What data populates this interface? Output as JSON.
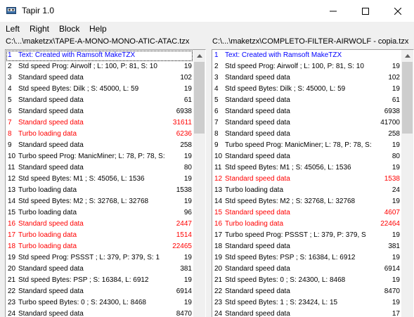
{
  "window": {
    "title": "Tapir 1.0",
    "minimize_glyph": "—",
    "maximize_glyph": "☐",
    "close_glyph": "✕"
  },
  "menu": [
    "Left",
    "Right",
    "Block",
    "Help"
  ],
  "left_panel": {
    "path": "C:\\...\\maketzx\\TAPE-A-MONO-MONO-ATIC-ATAC.tzx",
    "rows": [
      {
        "num": "1",
        "text": "Text: Created with Ramsoft MakeTZX",
        "value": "",
        "color": "blue"
      },
      {
        "num": "2",
        "text": "Std speed Prog: Airwolf   ; L: 100, P: 81, S: 10",
        "value": "19",
        "color": "black"
      },
      {
        "num": "3",
        "text": "Standard speed data",
        "value": "102",
        "color": "black"
      },
      {
        "num": "4",
        "text": "Std speed Bytes: Dilk      ; S: 45000, L: 59",
        "value": "19",
        "color": "black"
      },
      {
        "num": "5",
        "text": "Standard speed data",
        "value": "61",
        "color": "black"
      },
      {
        "num": "6",
        "text": "Standard speed data",
        "value": "6938",
        "color": "black"
      },
      {
        "num": "7",
        "text": "Standard speed data",
        "value": "31611",
        "color": "red"
      },
      {
        "num": "8",
        "text": "Turbo loading data",
        "value": "6236",
        "color": "red"
      },
      {
        "num": "9",
        "text": "Standard speed data",
        "value": "258",
        "color": "black"
      },
      {
        "num": "10",
        "text": "Turbo speed Prog: ManicMiner; L: 78, P: 78, S:",
        "value": "19",
        "color": "black"
      },
      {
        "num": "11",
        "text": "Standard speed data",
        "value": "80",
        "color": "black"
      },
      {
        "num": "12",
        "text": "Std speed Bytes: M1        ; S: 45056, L: 1536",
        "value": "19",
        "color": "black"
      },
      {
        "num": "13",
        "text": "Turbo loading data",
        "value": "1538",
        "color": "black"
      },
      {
        "num": "14",
        "text": "Std speed Bytes: M2        ; S: 32768, L: 32768",
        "value": "19",
        "color": "black"
      },
      {
        "num": "15",
        "text": "Turbo loading data",
        "value": "96",
        "color": "black"
      },
      {
        "num": "16",
        "text": "Standard speed data",
        "value": "2447",
        "color": "red"
      },
      {
        "num": "17",
        "text": "Turbo loading data",
        "value": "1514",
        "color": "red"
      },
      {
        "num": "18",
        "text": "Turbo loading data",
        "value": "22465",
        "color": "red"
      },
      {
        "num": "19",
        "text": "Std speed Prog: PSSST     ; L: 379, P: 379, S: 1",
        "value": "19",
        "color": "black"
      },
      {
        "num": "20",
        "text": "Standard speed data",
        "value": "381",
        "color": "black"
      },
      {
        "num": "21",
        "text": "Std speed Bytes: PSP       ; S: 16384, L: 6912",
        "value": "19",
        "color": "black"
      },
      {
        "num": "22",
        "text": "Standard speed data",
        "value": "6914",
        "color": "black"
      },
      {
        "num": "23",
        "text": "Turbo speed Bytes: 0       ; S: 24300, L: 8468",
        "value": "19",
        "color": "black"
      },
      {
        "num": "24",
        "text": "Standard speed data",
        "value": "8470",
        "color": "black"
      }
    ]
  },
  "right_panel": {
    "path": "C:\\...\\maketzx\\COMPLETO-FILTER-AIRWOLF - copia.tzx",
    "rows": [
      {
        "num": "1",
        "text": "Text: Created with Ramsoft MakeTZX",
        "value": "",
        "color": "blue"
      },
      {
        "num": "2",
        "text": "Std speed Prog: Airwolf   ; L: 100, P: 81, S: 10",
        "value": "19",
        "color": "black"
      },
      {
        "num": "3",
        "text": "Standard speed data",
        "value": "102",
        "color": "black"
      },
      {
        "num": "4",
        "text": "Std speed Bytes: Dilk      ; S: 45000, L: 59",
        "value": "19",
        "color": "black"
      },
      {
        "num": "5",
        "text": "Standard speed data",
        "value": "61",
        "color": "black"
      },
      {
        "num": "6",
        "text": "Standard speed data",
        "value": "6938",
        "color": "black"
      },
      {
        "num": "7",
        "text": "Standard speed data",
        "value": "41700",
        "color": "black"
      },
      {
        "num": "8",
        "text": "Standard speed data",
        "value": "258",
        "color": "black"
      },
      {
        "num": "9",
        "text": "Turbo speed Prog: ManicMiner; L: 78, P: 78, S:",
        "value": "19",
        "color": "black"
      },
      {
        "num": "10",
        "text": "Standard speed data",
        "value": "80",
        "color": "black"
      },
      {
        "num": "11",
        "text": "Std speed Bytes: M1        ; S: 45056, L: 1536",
        "value": "19",
        "color": "black"
      },
      {
        "num": "12",
        "text": "Standard speed data",
        "value": "1538",
        "color": "red"
      },
      {
        "num": "13",
        "text": "Turbo loading data",
        "value": "24",
        "color": "black"
      },
      {
        "num": "14",
        "text": "Std speed Bytes: M2        ; S: 32768, L: 32768",
        "value": "19",
        "color": "black"
      },
      {
        "num": "15",
        "text": "Standard speed data",
        "value": "4607",
        "color": "red"
      },
      {
        "num": "16",
        "text": "Turbo loading data",
        "value": "22464",
        "color": "red"
      },
      {
        "num": "17",
        "text": "Turbo speed Prog: PSSST    ; L: 379, P: 379, S",
        "value": "19",
        "color": "black"
      },
      {
        "num": "18",
        "text": "Standard speed data",
        "value": "381",
        "color": "black"
      },
      {
        "num": "19",
        "text": "Std speed Bytes: PSP       ; S: 16384, L: 6912",
        "value": "19",
        "color": "black"
      },
      {
        "num": "20",
        "text": "Standard speed data",
        "value": "6914",
        "color": "black"
      },
      {
        "num": "21",
        "text": "Std speed Bytes: 0         ; S: 24300, L: 8468",
        "value": "19",
        "color": "black"
      },
      {
        "num": "22",
        "text": "Standard speed data",
        "value": "8470",
        "color": "black"
      },
      {
        "num": "23",
        "text": "Std speed Bytes: 1         ; S: 23424, L: 15",
        "value": "19",
        "color": "black"
      },
      {
        "num": "24",
        "text": "Standard speed data",
        "value": "17",
        "color": "black"
      }
    ]
  },
  "colors": {
    "red": "#ff0000",
    "blue": "#0000ff",
    "black": "#000000"
  },
  "icons": {
    "app": "tape-icon",
    "scroll_up": "up-arrow",
    "scroll_down": "down-arrow"
  }
}
